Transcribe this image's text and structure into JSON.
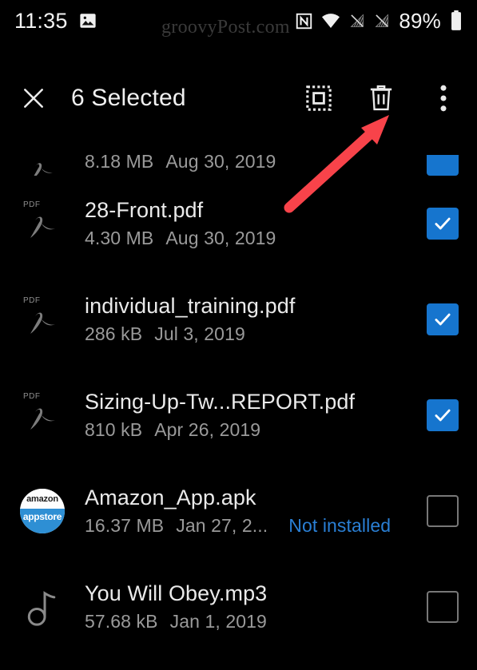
{
  "status_bar": {
    "time": "11:35",
    "battery_percent": "89%",
    "icons": [
      "image-notification-icon",
      "nfc-icon",
      "wifi-icon",
      "signal-off-icon",
      "signal-off-icon",
      "battery-icon"
    ]
  },
  "watermark": {
    "text": "groovyPost.com"
  },
  "action_bar": {
    "close_label": "✕",
    "title": "6 Selected",
    "select_all_icon": "select-all-icon",
    "delete_icon": "trash-icon",
    "overflow_icon": "more-vertical-icon"
  },
  "colors": {
    "accent_blue": "#1675ce",
    "link_blue": "#2a7fd4",
    "arrow_red": "#f8434a",
    "background": "#000000",
    "primary_text": "#eaeaea",
    "secondary_text": "#9a9a9a"
  },
  "files": [
    {
      "name": "",
      "size": "8.18 MB",
      "date": "Aug 30, 2019",
      "status": "",
      "icon": "pdf-icon",
      "checked": true,
      "clipped": true
    },
    {
      "name": "28-Front.pdf",
      "size": "4.30 MB",
      "date": "Aug 30, 2019",
      "status": "",
      "icon": "pdf-icon",
      "checked": true,
      "clipped": false
    },
    {
      "name": "individual_training.pdf",
      "size": "286 kB",
      "date": "Jul 3, 2019",
      "status": "",
      "icon": "pdf-icon",
      "checked": true,
      "clipped": false
    },
    {
      "name": "Sizing-Up-Tw...REPORT.pdf",
      "size": "810 kB",
      "date": "Apr 26, 2019",
      "status": "",
      "icon": "pdf-icon",
      "checked": true,
      "clipped": false
    },
    {
      "name": "Amazon_App.apk",
      "size": "16.37 MB",
      "date": "Jan 27, 2...",
      "status": "Not installed",
      "icon": "amazon-appstore-icon",
      "checked": false,
      "clipped": false
    },
    {
      "name": "You Will Obey.mp3",
      "size": "57.68 kB",
      "date": "Jan 1, 2019",
      "status": "",
      "icon": "music-note-icon",
      "checked": false,
      "clipped": false
    }
  ],
  "annotation": {
    "arrow_name": "red-arrow-pointing-to-delete"
  }
}
